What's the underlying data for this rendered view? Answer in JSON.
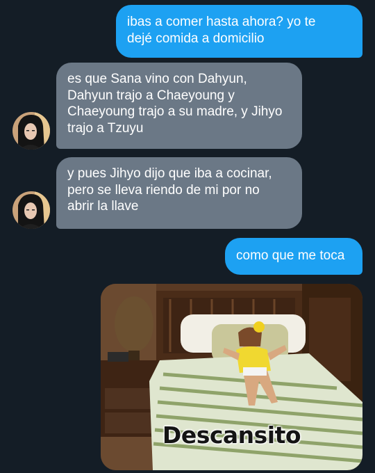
{
  "conversation": {
    "messages": [
      {
        "direction": "sent",
        "text": "ibas a comer hasta ahora? yo te\ndejé comida a domicilio"
      },
      {
        "direction": "received",
        "text": "es que Sana vino con Dahyun,\nDahyun trajo a Chaeyoung y\nChaeyoung trajo a su madre, y Jihyo\ntrajo a Tzuyu"
      },
      {
        "direction": "received",
        "text": "y pues Jihyo dijo que iba a cocinar,\npero se lleva riendo de mi por no\nabrir la llave"
      },
      {
        "direction": "sent",
        "text": "como que me toca"
      }
    ],
    "image_message": {
      "direction": "sent",
      "caption": "Descansito"
    }
  },
  "colors": {
    "background": "#141d26",
    "sent_bubble": "#1da1f2",
    "received_bubble": "#6b7886",
    "text": "#ffffff"
  },
  "icons": {
    "avatar": "user-avatar-photo"
  }
}
